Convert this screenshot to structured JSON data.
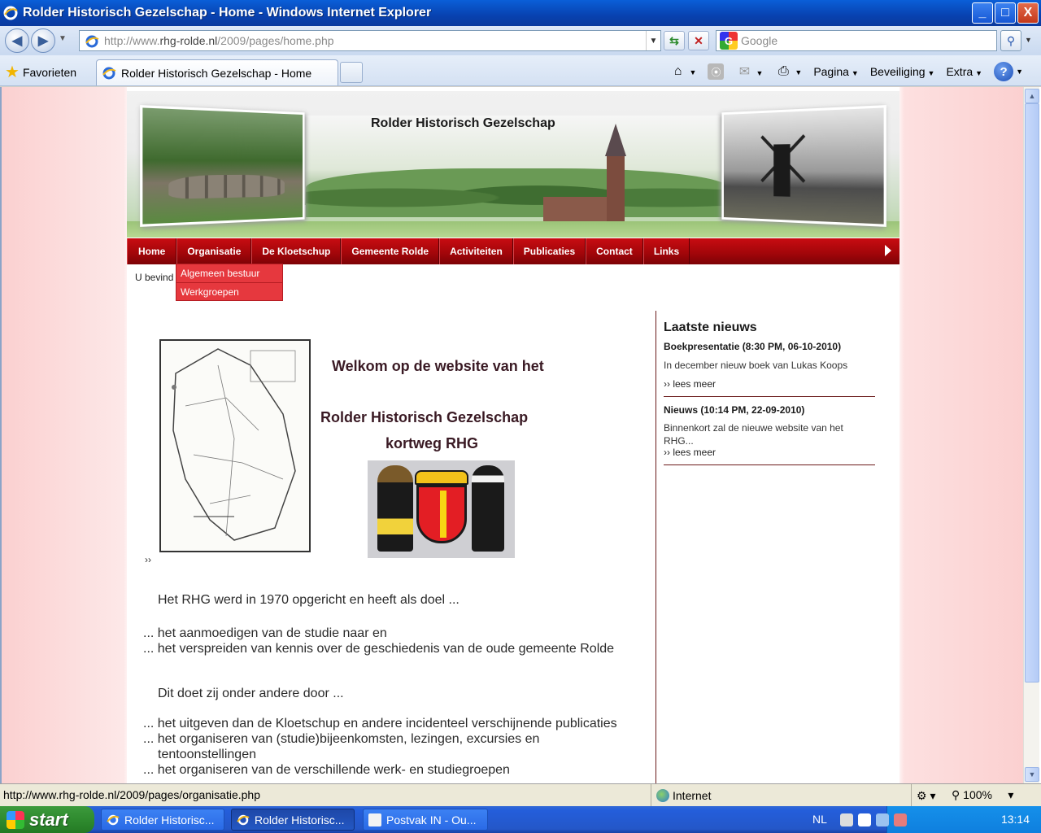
{
  "window": {
    "title": "Rolder Historisch Gezelschap - Home - Windows Internet Explorer",
    "buttons": {
      "minimize": "_",
      "maximize": "□",
      "close": "X"
    }
  },
  "address_bar": {
    "url_prefix": "http://www.",
    "url_domain": "rhg-rolde.nl",
    "url_path": "/2009/pages/home.php"
  },
  "search": {
    "placeholder": "Google"
  },
  "favorites_bar": {
    "favorites_label": "Favorieten",
    "tab_title": "Rolder Historisch Gezelschap - Home",
    "commands": {
      "page": "Pagina",
      "security": "Beveiliging",
      "tools": "Extra"
    }
  },
  "site": {
    "title": "Rolder Historisch Gezelschap",
    "nav": [
      "Home",
      "Organisatie",
      "De Kloetschup",
      "Gemeente Rolde",
      "Activiteiten",
      "Publicaties",
      "Contact",
      "Links"
    ],
    "submenu": [
      "Algemeen bestuur",
      "Werkgroepen"
    ],
    "breadcrumb": "U bevind",
    "welcome_line1": "Welkom op de website van het",
    "welcome_line2": "Rolder Historisch Gezelschap",
    "welcome_line3": "kortweg RHG",
    "map_arrow": "››",
    "body": {
      "intro": "Het RHG werd in 1970 opgericht en heeft als doel ...",
      "goals": [
        "... het aanmoedigen van de studie naar en",
        "... het verspreiden van kennis over de geschiedenis van de oude gemeente Rolde"
      ],
      "means_intro": "Dit doet zij onder andere door ...",
      "means": [
        "... het uitgeven dan de Kloetschup en andere incidenteel verschijnende publicaties",
        "... het organiseren van (studie)bijeenkomsten, lezingen, excursies en",
        "tentoonstellingen",
        "... het organiseren van de verschillende werk- en studiegroepen"
      ]
    },
    "sidebar": {
      "heading": "Laatste nieuws",
      "items": [
        {
          "title": "Boekpresentatie (8:30 PM, 06-10-2010)",
          "body": "In december nieuw boek van Lukas Koops",
          "more": "›› lees meer"
        },
        {
          "title": "Nieuws (10:14 PM, 22-09-2010)",
          "body": "Binnenkort zal de nieuwe website van het RHG...",
          "more": "›› lees meer"
        }
      ]
    }
  },
  "statusbar": {
    "url": "http://www.rhg-rolde.nl/2009/pages/organisatie.php",
    "zone": "Internet",
    "zoom": "100%"
  },
  "taskbar": {
    "start": "start",
    "tasks": [
      "Rolder Historisc...",
      "Rolder Historisc...",
      "Postvak IN - Ou..."
    ],
    "language": "NL",
    "time": "13:14"
  }
}
